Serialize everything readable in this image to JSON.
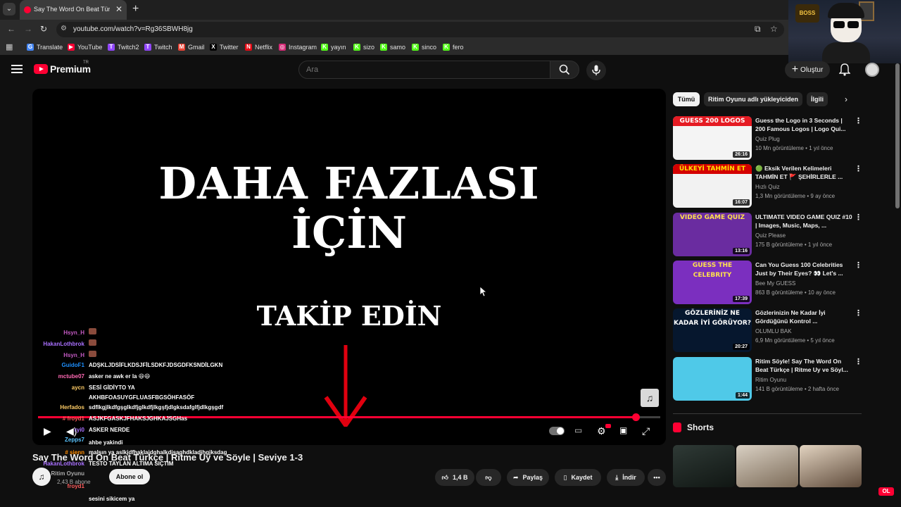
{
  "browser": {
    "tab_title": "Say The Word On Beat Türkçe |",
    "tab_close": "✕",
    "new_tab": "+",
    "url": "youtube.com/watch?v=Rg36SBWH8jg",
    "bookmarks": [
      {
        "label": "Translate",
        "color": "#4285f4",
        "glyph": "G"
      },
      {
        "label": "YouTube",
        "color": "#ff0033",
        "glyph": "▶"
      },
      {
        "label": "Twitch2",
        "color": "#9146ff",
        "glyph": "T"
      },
      {
        "label": "Twitch",
        "color": "#9146ff",
        "glyph": "T"
      },
      {
        "label": "Gmail",
        "color": "#ea4335",
        "glyph": "M"
      },
      {
        "label": "Twitter",
        "color": "#000000",
        "glyph": "X"
      },
      {
        "label": "Netflix",
        "color": "#e50914",
        "glyph": "N"
      },
      {
        "label": "Instagram",
        "color": "#d62976",
        "glyph": "◎"
      },
      {
        "label": "yayın",
        "color": "#53fc18",
        "glyph": "K"
      },
      {
        "label": "sizo",
        "color": "#53fc18",
        "glyph": "K"
      },
      {
        "label": "samo",
        "color": "#53fc18",
        "glyph": "K"
      },
      {
        "label": "sinco",
        "color": "#53fc18",
        "glyph": "K"
      },
      {
        "label": "fero",
        "color": "#53fc18",
        "glyph": "K"
      }
    ]
  },
  "webcam": {
    "badge": "BOSS"
  },
  "header": {
    "logo_text": "Premium",
    "logo_region": "TR",
    "search_placeholder": "Ara",
    "create_label": "Oluştur"
  },
  "player": {
    "line1": "DAHA FAZLASI",
    "line2": "İÇİN",
    "line3": "TAKİP EDİN",
    "progress": 0.96,
    "accent": "#ff0033"
  },
  "chat": [
    {
      "name": "Hsyn_H",
      "color": "#c45ac4",
      "msg": "",
      "emote": true
    },
    {
      "name": "HakanLothbrok",
      "color": "#a970ff",
      "msg": "",
      "emote": true
    },
    {
      "name": "Hsyn_H",
      "color": "#c45ac4",
      "msg": "",
      "emote": true
    },
    {
      "name": "GuidoF1",
      "color": "#1e90ff",
      "msg": "ADŞKLJDSİFLKDSJFİLSDKFJDSGDFKSNDİLGKN",
      "emote": false
    },
    {
      "name": "mctube07",
      "color": "#ff69b4",
      "msg": "asker ne awk er la 😆😆",
      "emote": false
    },
    {
      "name": "aycn",
      "color": "#ffcc66",
      "msg": "SESİ GİDİYTO YA",
      "emote": false
    },
    {
      "name": "",
      "color": "#ffffff",
      "msg": "AKHBFOASUYGFLUASFBGSÖHFASÖF",
      "emote": false
    },
    {
      "name": "Herfados",
      "color": "#ffcc66",
      "msg": "sdflkgjlkdfgşglkdfjglkdfjlkgşfjdlgksdafglfjdlkgşgdf",
      "emote": false
    },
    {
      "name": "# froyd1",
      "color": "#ff5c5c",
      "msg": "ASJKFGASKJFHAKSJGHKAJSGHas",
      "emote": false
    },
    {
      "name": "ryi0",
      "color": "#a970ff",
      "msg": "ASKER NERDE",
      "emote": false
    },
    {
      "name": "Zepps7",
      "color": "#5ac4ff",
      "msg": "",
      "emote": false
    },
    {
      "name": "",
      "color": "#ffffff",
      "msg": "ahbe yakindi",
      "emote": false
    },
    {
      "name": "# sienn",
      "color": "#ff8c00",
      "msg": "malsın ya aslkjdfhaklajdghalkdjsaghdkladjhgjksdag",
      "emote": false
    },
    {
      "name": "HakanLothbrok",
      "color": "#a970ff",
      "msg": "TESTO TAYLAN ALTIMA SIÇTIM",
      "emote": false
    },
    {
      "name": "Ritim Oyunu",
      "color": "#aaaaaa",
      "msg": "",
      "emote": false
    },
    {
      "name": "froyd1",
      "color": "#ff5c5c",
      "msg": "",
      "emote": false
    },
    {
      "name": "",
      "color": "#ff5c5c",
      "msg": "sesini sikicem ya",
      "emote": false
    }
  ],
  "video": {
    "title": "Say The Word On Beat Türkçe | Ritme Uy ve Söyle | Seviye 1-3",
    "channel_avatar_glyph": "♫",
    "subs": "2,43 B abone",
    "subscribe": "Abone ol",
    "likes": "1,4 B",
    "share": "Paylaş",
    "save": "Kaydet",
    "download": "İndir"
  },
  "chips": [
    "Tümü",
    "Ritim Oyunu adlı yükleyiciden",
    "İlgili"
  ],
  "recommendations": [
    {
      "title": "Guess the Logo in 3 Seconds | 200 Famous Logos | Logo Qui...",
      "channel": "Quiz Plug",
      "views": "10 Mn görüntüleme",
      "age": "1 yıl önce",
      "duration": "26:16",
      "caption": "GUESS 200 LOGOS",
      "bg": "#f4f4f4",
      "cap_bg": "#e51b23",
      "cap_color": "#ffffff"
    },
    {
      "title": "🟢 Eksik Verilen Kelimeleri TAHMİN ET 🚩 ŞEHİRLERLE ...",
      "channel": "Hızlı Quiz",
      "views": "1,3 Mn görüntüleme",
      "age": "9 ay önce",
      "duration": "16:07",
      "caption": "ÜLKEYİ TAHMİN ET",
      "bg": "#f2f2f2",
      "cap_bg": "#d40000",
      "cap_color": "#ffe400"
    },
    {
      "title": "ULTIMATE VIDEO GAME QUIZ #10 | Images, Music, Maps, ...",
      "channel": "Quiz Please",
      "views": "175 B görüntüleme",
      "age": "1 yıl önce",
      "duration": "13:16",
      "caption": "VIDEO GAME QUIZ",
      "bg": "#6a2ca0",
      "cap_bg": "transparent",
      "cap_color": "#ffe14d"
    },
    {
      "title": "Can You Guess 100 Celebrities Just by Their Eyes? 👀 Let's ...",
      "channel": "Bee My GUESS",
      "views": "863 B görüntüleme",
      "age": "10 ay önce",
      "duration": "17:39",
      "caption": "GUESS THE CELEBRITY",
      "bg": "#7b2fbf",
      "cap_bg": "transparent",
      "cap_color": "#ffe14d"
    },
    {
      "title": "Gözlerinizin Ne Kadar İyi Gördüğünü Kontrol ...",
      "channel": "OLUMLU BAK",
      "views": "6,9 Mn görüntüleme",
      "age": "5 yıl önce",
      "duration": "20:27",
      "caption": "GÖZLERİNİZ NE KADAR İYİ GÖRÜYOR?",
      "bg": "#06172e",
      "cap_bg": "transparent",
      "cap_color": "#ffffff"
    },
    {
      "title": "Ritim Söyle! Say The Word On Beat Türkçe | Ritme Uy ve Söyl...",
      "channel": "Ritim Oyunu",
      "views": "141 B görüntüleme",
      "age": "2 hafta önce",
      "duration": "1:44",
      "caption": "",
      "bg": "#4fc9e8",
      "cap_bg": "transparent",
      "cap_color": "#ffffff"
    }
  ],
  "shorts": {
    "label": "Shorts"
  },
  "live_badge": "OL"
}
